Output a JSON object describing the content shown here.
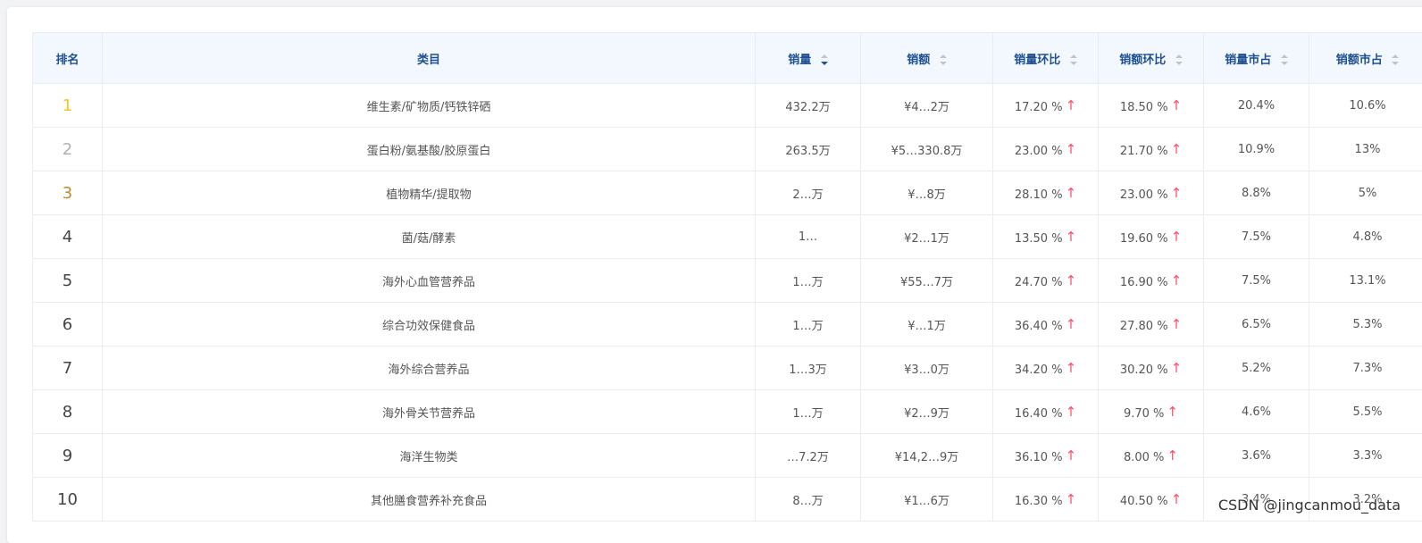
{
  "headers": {
    "rank": "排名",
    "category": "类目",
    "sales_volume": "销量",
    "sales_amount": "销额",
    "volume_mom": "销量环比",
    "amount_mom": "销额环比",
    "volume_share": "销量市占",
    "amount_share": "销额市占"
  },
  "sort_state": {
    "active_column": "销量",
    "direction": "descending"
  },
  "colors": {
    "up_arrow": "#ff4d6a",
    "header_text": "#1d4f91",
    "header_bg": "#f3f8ff"
  },
  "rows": [
    {
      "rank": "1",
      "category": "维生素/矿物质/钙铁锌硒",
      "volume": "432.2万",
      "amount": "¥4…2万",
      "volume_mom": "17.20 %",
      "amount_mom": "18.50 %",
      "volume_share": "20.4%",
      "amount_share": "10.6%"
    },
    {
      "rank": "2",
      "category": "蛋白粉/氨基酸/胶原蛋白",
      "volume": "263.5万",
      "amount": "¥5…330.8万",
      "volume_mom": "23.00 %",
      "amount_mom": "21.70 %",
      "volume_share": "10.9%",
      "amount_share": "13%"
    },
    {
      "rank": "3",
      "category": "植物精华/提取物",
      "volume": "2…万",
      "amount": "¥…8万",
      "volume_mom": "28.10 %",
      "amount_mom": "23.00 %",
      "volume_share": "8.8%",
      "amount_share": "5%"
    },
    {
      "rank": "4",
      "category": "菌/菇/酵素",
      "volume": "1…",
      "amount": "¥2…1万",
      "volume_mom": "13.50 %",
      "amount_mom": "19.60 %",
      "volume_share": "7.5%",
      "amount_share": "4.8%"
    },
    {
      "rank": "5",
      "category": "海外心血管营养品",
      "volume": "1…万",
      "amount": "¥55…7万",
      "volume_mom": "24.70 %",
      "amount_mom": "16.90 %",
      "volume_share": "7.5%",
      "amount_share": "13.1%"
    },
    {
      "rank": "6",
      "category": "综合功效保健食品",
      "volume": "1…万",
      "amount": "¥…1万",
      "volume_mom": "36.40 %",
      "amount_mom": "27.80 %",
      "volume_share": "6.5%",
      "amount_share": "5.3%"
    },
    {
      "rank": "7",
      "category": "海外综合营养品",
      "volume": "1…3万",
      "amount": "¥3…0万",
      "volume_mom": "34.20 %",
      "amount_mom": "30.20 %",
      "volume_share": "5.2%",
      "amount_share": "7.3%"
    },
    {
      "rank": "8",
      "category": "海外骨关节营养品",
      "volume": "1…万",
      "amount": "¥2…9万",
      "volume_mom": "16.40 %",
      "amount_mom": "9.70 %",
      "volume_share": "4.6%",
      "amount_share": "5.5%"
    },
    {
      "rank": "9",
      "category": "海洋生物类",
      "volume": "…7.2万",
      "amount": "¥14,2…9万",
      "volume_mom": "36.10 %",
      "amount_mom": "8.00 %",
      "volume_share": "3.6%",
      "amount_share": "3.3%"
    },
    {
      "rank": "10",
      "category": "其他膳食营养补充食品",
      "volume": "8…万",
      "amount": "¥1…6万",
      "volume_mom": "16.30 %",
      "amount_mom": "40.50 %",
      "volume_share": "3.4%",
      "amount_share": "3.2%"
    }
  ],
  "watermark": "CSDN @jingcanmou_data"
}
